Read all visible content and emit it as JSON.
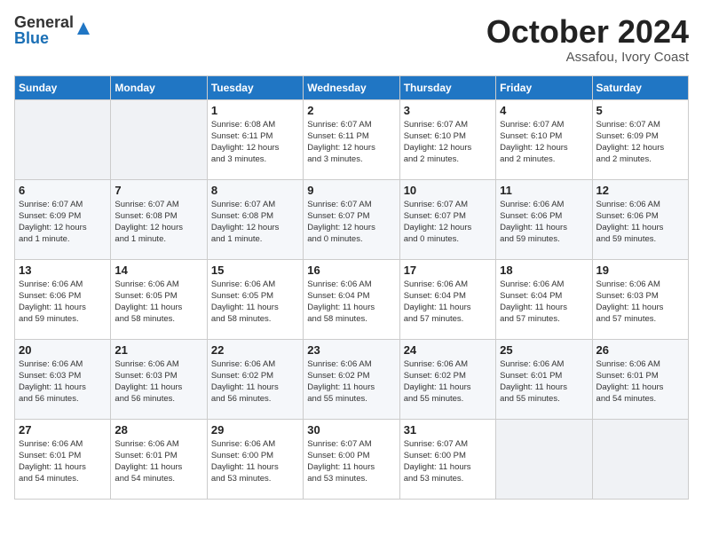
{
  "logo": {
    "line1": "General",
    "line2": "Blue"
  },
  "title": "October 2024",
  "location": "Assafou, Ivory Coast",
  "days_header": [
    "Sunday",
    "Monday",
    "Tuesday",
    "Wednesday",
    "Thursday",
    "Friday",
    "Saturday"
  ],
  "weeks": [
    [
      {
        "day": "",
        "info": ""
      },
      {
        "day": "",
        "info": ""
      },
      {
        "day": "1",
        "info": "Sunrise: 6:08 AM\nSunset: 6:11 PM\nDaylight: 12 hours\nand 3 minutes."
      },
      {
        "day": "2",
        "info": "Sunrise: 6:07 AM\nSunset: 6:11 PM\nDaylight: 12 hours\nand 3 minutes."
      },
      {
        "day": "3",
        "info": "Sunrise: 6:07 AM\nSunset: 6:10 PM\nDaylight: 12 hours\nand 2 minutes."
      },
      {
        "day": "4",
        "info": "Sunrise: 6:07 AM\nSunset: 6:10 PM\nDaylight: 12 hours\nand 2 minutes."
      },
      {
        "day": "5",
        "info": "Sunrise: 6:07 AM\nSunset: 6:09 PM\nDaylight: 12 hours\nand 2 minutes."
      }
    ],
    [
      {
        "day": "6",
        "info": "Sunrise: 6:07 AM\nSunset: 6:09 PM\nDaylight: 12 hours\nand 1 minute."
      },
      {
        "day": "7",
        "info": "Sunrise: 6:07 AM\nSunset: 6:08 PM\nDaylight: 12 hours\nand 1 minute."
      },
      {
        "day": "8",
        "info": "Sunrise: 6:07 AM\nSunset: 6:08 PM\nDaylight: 12 hours\nand 1 minute."
      },
      {
        "day": "9",
        "info": "Sunrise: 6:07 AM\nSunset: 6:07 PM\nDaylight: 12 hours\nand 0 minutes."
      },
      {
        "day": "10",
        "info": "Sunrise: 6:07 AM\nSunset: 6:07 PM\nDaylight: 12 hours\nand 0 minutes."
      },
      {
        "day": "11",
        "info": "Sunrise: 6:06 AM\nSunset: 6:06 PM\nDaylight: 11 hours\nand 59 minutes."
      },
      {
        "day": "12",
        "info": "Sunrise: 6:06 AM\nSunset: 6:06 PM\nDaylight: 11 hours\nand 59 minutes."
      }
    ],
    [
      {
        "day": "13",
        "info": "Sunrise: 6:06 AM\nSunset: 6:06 PM\nDaylight: 11 hours\nand 59 minutes."
      },
      {
        "day": "14",
        "info": "Sunrise: 6:06 AM\nSunset: 6:05 PM\nDaylight: 11 hours\nand 58 minutes."
      },
      {
        "day": "15",
        "info": "Sunrise: 6:06 AM\nSunset: 6:05 PM\nDaylight: 11 hours\nand 58 minutes."
      },
      {
        "day": "16",
        "info": "Sunrise: 6:06 AM\nSunset: 6:04 PM\nDaylight: 11 hours\nand 58 minutes."
      },
      {
        "day": "17",
        "info": "Sunrise: 6:06 AM\nSunset: 6:04 PM\nDaylight: 11 hours\nand 57 minutes."
      },
      {
        "day": "18",
        "info": "Sunrise: 6:06 AM\nSunset: 6:04 PM\nDaylight: 11 hours\nand 57 minutes."
      },
      {
        "day": "19",
        "info": "Sunrise: 6:06 AM\nSunset: 6:03 PM\nDaylight: 11 hours\nand 57 minutes."
      }
    ],
    [
      {
        "day": "20",
        "info": "Sunrise: 6:06 AM\nSunset: 6:03 PM\nDaylight: 11 hours\nand 56 minutes."
      },
      {
        "day": "21",
        "info": "Sunrise: 6:06 AM\nSunset: 6:03 PM\nDaylight: 11 hours\nand 56 minutes."
      },
      {
        "day": "22",
        "info": "Sunrise: 6:06 AM\nSunset: 6:02 PM\nDaylight: 11 hours\nand 56 minutes."
      },
      {
        "day": "23",
        "info": "Sunrise: 6:06 AM\nSunset: 6:02 PM\nDaylight: 11 hours\nand 55 minutes."
      },
      {
        "day": "24",
        "info": "Sunrise: 6:06 AM\nSunset: 6:02 PM\nDaylight: 11 hours\nand 55 minutes."
      },
      {
        "day": "25",
        "info": "Sunrise: 6:06 AM\nSunset: 6:01 PM\nDaylight: 11 hours\nand 55 minutes."
      },
      {
        "day": "26",
        "info": "Sunrise: 6:06 AM\nSunset: 6:01 PM\nDaylight: 11 hours\nand 54 minutes."
      }
    ],
    [
      {
        "day": "27",
        "info": "Sunrise: 6:06 AM\nSunset: 6:01 PM\nDaylight: 11 hours\nand 54 minutes."
      },
      {
        "day": "28",
        "info": "Sunrise: 6:06 AM\nSunset: 6:01 PM\nDaylight: 11 hours\nand 54 minutes."
      },
      {
        "day": "29",
        "info": "Sunrise: 6:06 AM\nSunset: 6:00 PM\nDaylight: 11 hours\nand 53 minutes."
      },
      {
        "day": "30",
        "info": "Sunrise: 6:07 AM\nSunset: 6:00 PM\nDaylight: 11 hours\nand 53 minutes."
      },
      {
        "day": "31",
        "info": "Sunrise: 6:07 AM\nSunset: 6:00 PM\nDaylight: 11 hours\nand 53 minutes."
      },
      {
        "day": "",
        "info": ""
      },
      {
        "day": "",
        "info": ""
      }
    ]
  ]
}
